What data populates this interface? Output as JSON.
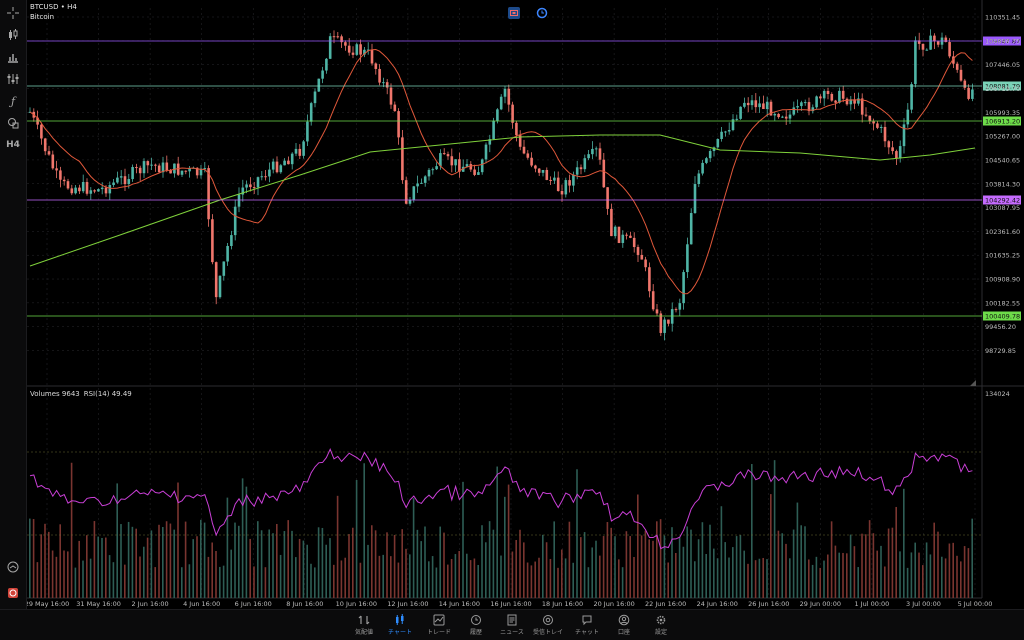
{
  "header": {
    "symbol": "BTCUSD",
    "timeframe": "H4",
    "description": "Bitcoin"
  },
  "left_toolbar": {
    "icons": [
      "crosshair-icon",
      "candlestick-icon",
      "bar-chart-icon",
      "indicators-icon",
      "function-icon",
      "objects-icon",
      "timeframe-icon"
    ],
    "timeframe_label": "H4",
    "bottom_icons": [
      "speed-icon",
      "account-icon"
    ]
  },
  "price_axis": {
    "ticks": [
      "110351.45",
      "108898.75",
      "107446.05",
      "106719.70",
      "105993.35",
      "105267.00",
      "104540.65",
      "103814.30",
      "103087.95",
      "102361.60",
      "101635.25",
      "100908.90",
      "100182.55",
      "99456.20",
      "98729.85"
    ],
    "levels": [
      {
        "label": "109647.87",
        "color": "#9b59ff",
        "text_color": "#111"
      },
      {
        "label": "108081.79",
        "color": "#7ad3b8",
        "text_color": "#111"
      },
      {
        "label": "106913.20",
        "color": "#6edc4a",
        "text_color": "#111"
      },
      {
        "label": "104292.42",
        "color": "#c56bff",
        "text_color": "#111"
      },
      {
        "label": "100409.78",
        "color": "#6edc4a",
        "text_color": "#111"
      }
    ]
  },
  "indicator_panel": {
    "volumes_label": "Volumes 9643",
    "rsi_label": "RSI(14) 49.49",
    "axis_max": "134024"
  },
  "time_axis": [
    "29 May 16:00",
    "31 May 16:00",
    "2 Jun 16:00",
    "4 Jun 16:00",
    "6 Jun 16:00",
    "8 Jun 16:00",
    "10 Jun 16:00",
    "12 Jun 16:00",
    "14 Jun 16:00",
    "16 Jun 16:00",
    "18 Jun 16:00",
    "20 Jun 16:00",
    "22 Jun 16:00",
    "24 Jun 16:00",
    "26 Jun 16:00",
    "29 Jun 00:00",
    "1 Jul 00:00",
    "3 Jul 00:00",
    "5 Jul 00:00"
  ],
  "bottom_nav": [
    {
      "label": "気配値",
      "icon": "quotes-icon",
      "active": false
    },
    {
      "label": "チャート",
      "icon": "chart-icon",
      "active": true
    },
    {
      "label": "トレード",
      "icon": "trade-icon",
      "active": false
    },
    {
      "label": "履歴",
      "icon": "history-icon",
      "active": false
    },
    {
      "label": "ニュース",
      "icon": "news-icon",
      "active": false
    },
    {
      "label": "受信トレイ",
      "icon": "inbox-icon",
      "active": false
    },
    {
      "label": "チャット",
      "icon": "chat-icon",
      "active": false
    },
    {
      "label": "口座",
      "icon": "account-icon",
      "active": false
    },
    {
      "label": "設定",
      "icon": "settings-icon",
      "active": false
    }
  ],
  "colors": {
    "bull": "#4fb5a6",
    "bear": "#f0766c",
    "ma_fast": "#e0583a",
    "ma_slow": "#7fd13b",
    "rsi": "#c93fd6",
    "grid": "#2a2a2e"
  }
}
